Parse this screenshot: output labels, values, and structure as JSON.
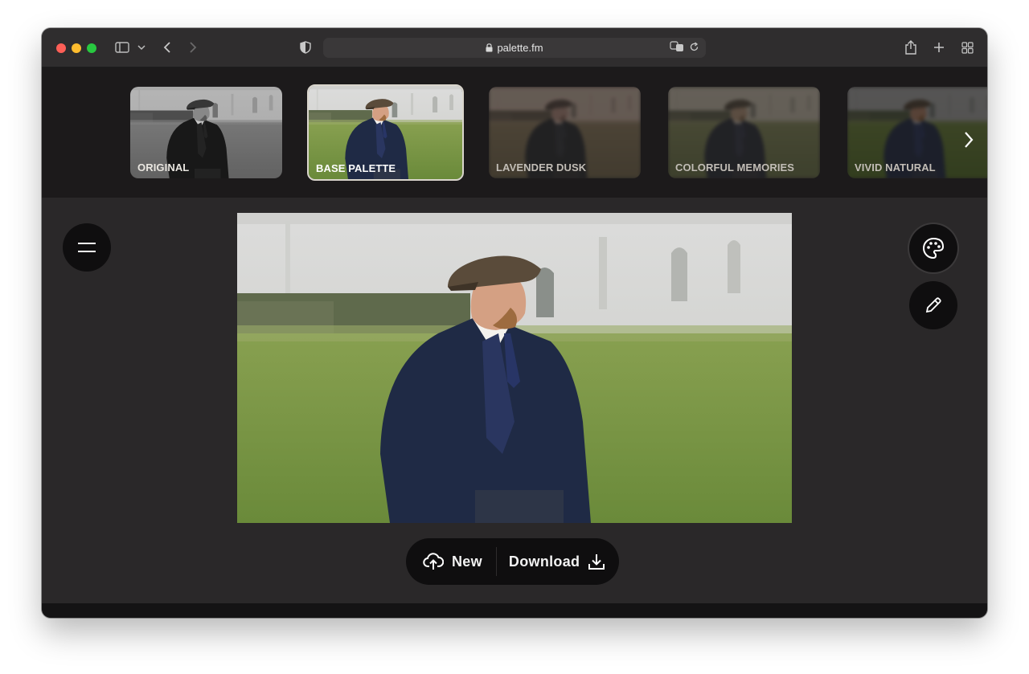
{
  "browser": {
    "url": "palette.fm"
  },
  "palettes": [
    {
      "label": "ORIGINAL",
      "selected": false
    },
    {
      "label": "BASE PALETTE",
      "selected": true
    },
    {
      "label": "LAVENDER DUSK",
      "selected": false
    },
    {
      "label": "COLORFUL MEMORIES",
      "selected": false
    },
    {
      "label": "VIVID NATURAL",
      "selected": false
    }
  ],
  "actions": {
    "new_label": "New",
    "download_label": "Download"
  },
  "icons": {
    "menu": "menu-icon",
    "palette": "palette-icon",
    "edit": "pencil-icon",
    "upload": "cloud-upload-icon",
    "download": "download-icon",
    "next": "chevron-right-icon"
  },
  "colors": {
    "app_background": "#2a2829",
    "strip_background": "#1c1a1b",
    "button_background": "#0f0e0f",
    "selected_border": "#d9d5cc"
  }
}
